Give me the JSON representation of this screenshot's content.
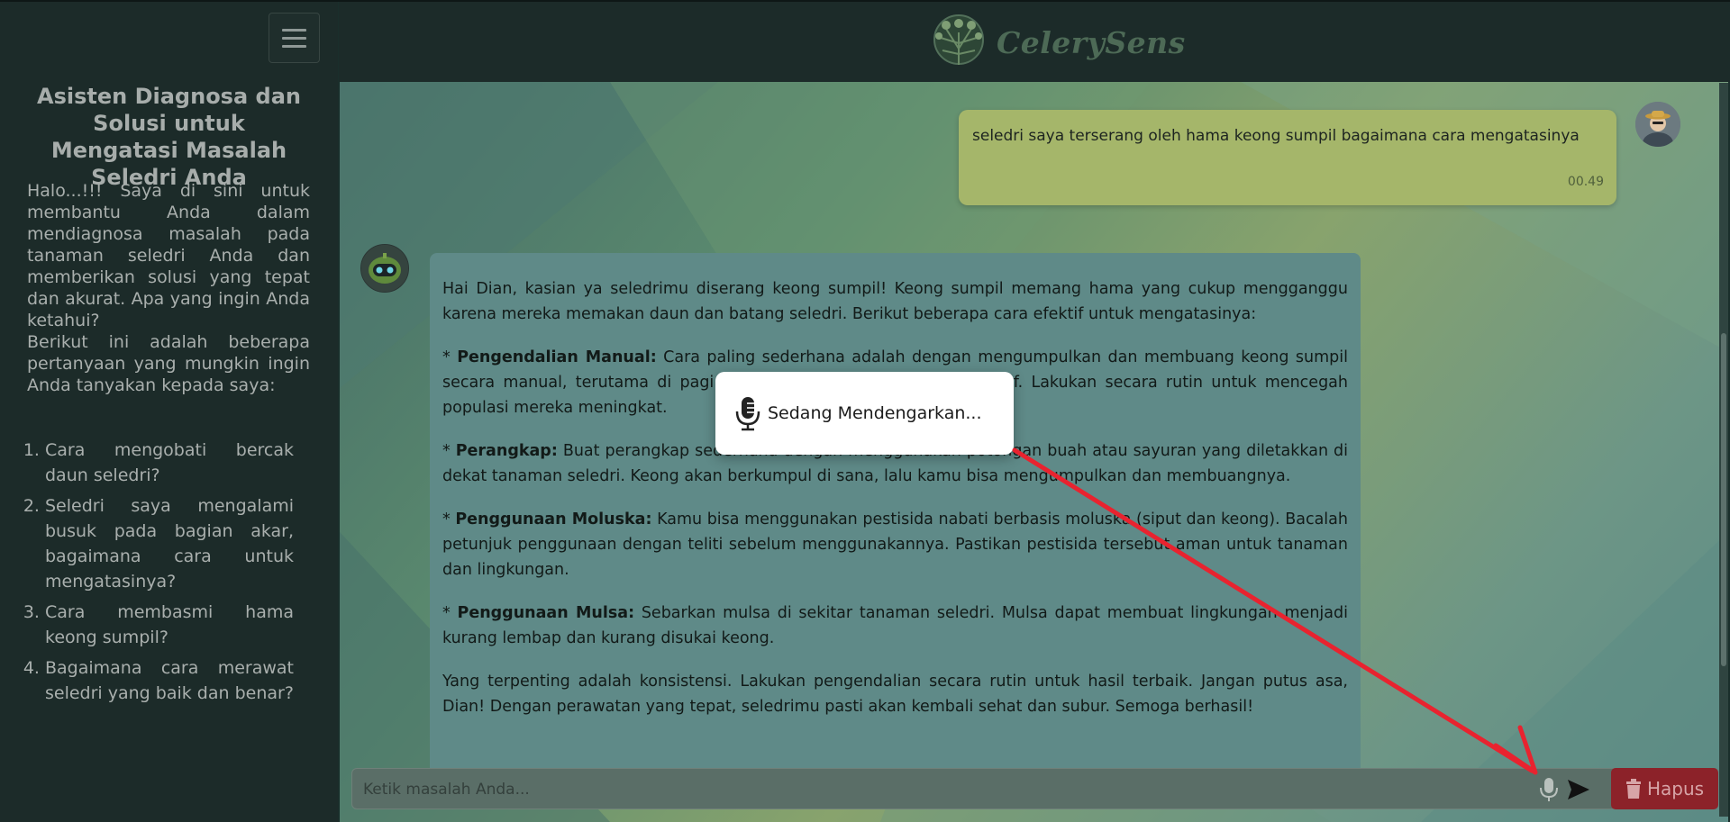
{
  "sidebar": {
    "title": "Asisten Diagnosa dan Solusi untuk Mengatasi Masalah Seledri Anda",
    "intro": "Halo...!!! Saya di sini untuk membantu Anda dalam mendiagnosa masalah pada tanaman seledri Anda dan memberikan solusi yang tepat dan akurat. Apa yang ingin Anda ketahui?",
    "intro2": "Berikut ini adalah beberapa pertanyaan yang mungkin ingin Anda tanyakan kepada saya:",
    "questions": [
      "Cara mengobati bercak daun seledri?",
      "Seledri saya mengalami busuk pada bagian akar, bagaimana cara untuk mengatasinya?",
      "Cara membasmi hama keong sumpil?",
      "Bagaimana cara merawat seledri yang baik dan benar?"
    ]
  },
  "header": {
    "brand": "CelerySens"
  },
  "chat": {
    "user_message": "seledri saya terserang oleh hama keong sumpil bagaimana cara mengatasinya",
    "user_time": "00.49",
    "bot": {
      "intro": "Hai Dian, kasian ya seledrimu diserang keong sumpil! Keong sumpil memang hama yang cukup mengganggu karena mereka memakan daun dan batang seledri. Berikut beberapa cara efektif untuk mengatasinya:",
      "tips": [
        {
          "title": "Pengendalian Manual:",
          "text": "Cara paling sederhana adalah dengan mengumpulkan dan membuang keong sumpil secara manual, terutama di pagi hari atau sore hari saat keong aktif. Lakukan secara rutin untuk mencegah populasi mereka meningkat."
        },
        {
          "title": "Perangkap:",
          "text": "Buat perangkap sederhana dengan menggunakan potongan buah atau sayuran yang diletakkan di dekat tanaman seledri. Keong akan berkumpul di sana, lalu kamu bisa mengumpulkan dan membuangnya."
        },
        {
          "title": "Penggunaan Moluska:",
          "text": "Kamu bisa menggunakan pestisida nabati berbasis moluska (siput dan keong). Bacalah petunjuk penggunaan dengan teliti sebelum menggunakannya. Pastikan pestisida tersebut aman untuk tanaman dan lingkungan."
        },
        {
          "title": "Penggunaan Mulsa:",
          "text": "Sebarkan mulsa di sekitar tanaman seledri. Mulsa dapat membuat lingkungan menjadi kurang lembap dan kurang disukai keong."
        }
      ],
      "closing": "Yang terpenting adalah konsistensi. Lakukan pengendalian secara rutin untuk hasil terbaik. Jangan putus asa, Dian! Dengan perawatan yang tepat, seledrimu pasti akan kembali sehat dan subur. Semoga berhasil!"
    }
  },
  "listening": {
    "label": "Sedang Mendengarkan..."
  },
  "input": {
    "placeholder": "Ketik masalah Anda..."
  },
  "buttons": {
    "clear_label": "Hapus"
  },
  "colors": {
    "annotation_arrow": "#e8232f",
    "clear_button": "#8c2229"
  }
}
